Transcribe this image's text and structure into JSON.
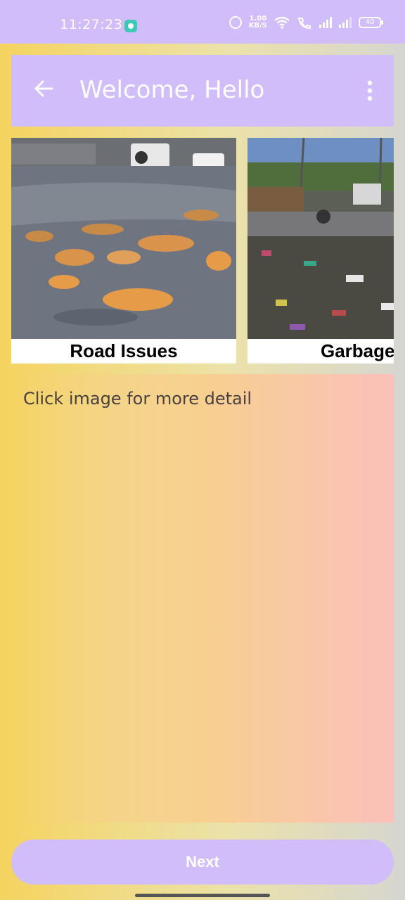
{
  "status_bar": {
    "time": "11:27:23",
    "net_speed_value": "1.00",
    "net_speed_unit": "KB/S",
    "battery": "40"
  },
  "app_bar": {
    "title": "Welcome, Hello",
    "back_icon": "arrow-left-icon",
    "menu_icon": "more-vert-icon",
    "color": "#d0bdfa"
  },
  "carousel": {
    "items": [
      {
        "label": "Road Issues",
        "image": "road-potholes-photo"
      },
      {
        "label": "Garbage",
        "image": "garbage-dump-photo"
      }
    ]
  },
  "hint": "Click image for more detail",
  "next_button": {
    "label": "Next"
  }
}
